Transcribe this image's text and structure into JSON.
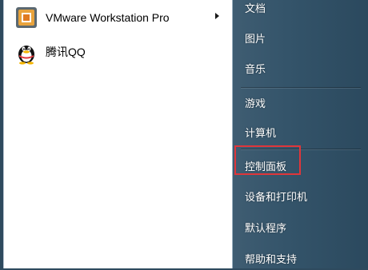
{
  "programs": [
    {
      "label": "VMware Workstation Pro",
      "icon": "vmware-icon",
      "has_submenu": true
    },
    {
      "label": "腾讯QQ",
      "icon": "qq-penguin-icon",
      "has_submenu": false
    }
  ],
  "places": [
    {
      "label": "文档"
    },
    {
      "label": "图片"
    },
    {
      "label": "音乐"
    },
    {
      "label": "游戏"
    },
    {
      "label": "计算机"
    },
    {
      "label": "控制面板"
    },
    {
      "label": "设备和打印机"
    },
    {
      "label": "默认程序"
    },
    {
      "label": "帮助和支持"
    }
  ],
  "colors": {
    "highlight": "#e0363a",
    "right_pane": "#34546a",
    "left_pane": "#ffffff"
  }
}
